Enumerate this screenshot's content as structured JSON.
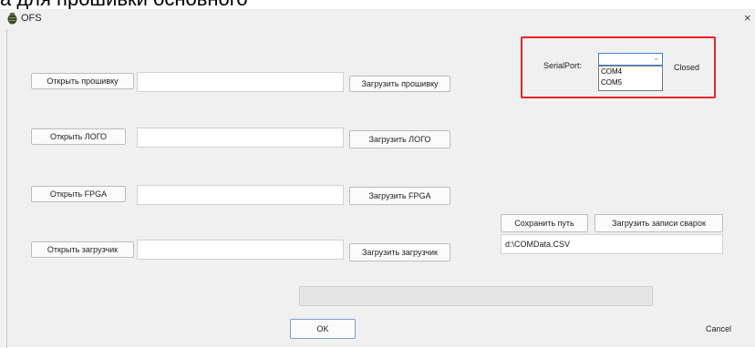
{
  "caption": "а для прошивки основного",
  "window": {
    "title": "OFS",
    "close_glyph": "×"
  },
  "firmware": {
    "open_label": "Открыть прошивку",
    "path": "",
    "upload_label": "Загрузить прошивку"
  },
  "logo": {
    "open_label": "Открыть ЛОГО",
    "path": "",
    "upload_label": "Загрузить ЛОГО"
  },
  "fpga": {
    "open_label": "Открыть FPGA",
    "path": "",
    "upload_label": "Загрузить FPGA"
  },
  "bootloader": {
    "open_label": "Открыть загрузчик",
    "path": "",
    "upload_label": "Загрузить загрузчик"
  },
  "serial": {
    "label": "SerialPort:",
    "selected": "",
    "status": "Closed",
    "options": [
      "COM4",
      "COM5"
    ]
  },
  "records": {
    "save_path_label": "Сохранить путь",
    "load_records_label": "Загрузить записи сварок",
    "path_value": "d:\\COMData.CSV"
  },
  "progress": {
    "value": 0
  },
  "footer": {
    "ok_label": "OK",
    "cancel_label": "Cancel"
  },
  "colors": {
    "highlight": "#e8222b",
    "combo_focus": "#3c86d6",
    "window_bg": "#f0f0f0"
  },
  "icons": {
    "app": "app-icon",
    "dropdown": "chevron-down-icon"
  }
}
